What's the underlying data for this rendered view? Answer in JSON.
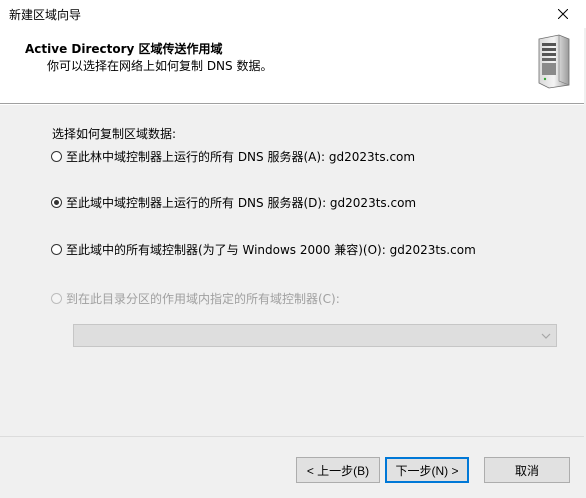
{
  "window": {
    "title": "新建区域向导"
  },
  "header": {
    "title": "Active Directory 区域传送作用域",
    "subtitle": "你可以选择在网络上如何复制 DNS 数据。",
    "icon": "server-icon"
  },
  "main": {
    "section_label": "选择如何复制区域数据:",
    "options": [
      {
        "label": "至此林中域控制器上运行的所有 DNS 服务器(A): gd2023ts.com",
        "checked": false,
        "disabled": false
      },
      {
        "label": "至此域中域控制器上运行的所有 DNS 服务器(D): gd2023ts.com",
        "checked": true,
        "disabled": false
      },
      {
        "label": "至此域中的所有域控制器(为了与 Windows 2000 兼容)(O): gd2023ts.com",
        "checked": false,
        "disabled": false
      },
      {
        "label": "到在此目录分区的作用域内指定的所有域控制器(C):",
        "checked": false,
        "disabled": true
      }
    ],
    "partition_select": {
      "value": "",
      "disabled": true
    }
  },
  "footer": {
    "back_label": "< 上一步(B)",
    "next_label": "下一步(N) >",
    "cancel_label": "取消"
  },
  "colors": {
    "accent": "#0078d7",
    "dialog_bg": "#f0f0f0",
    "header_bg": "#ffffff"
  }
}
